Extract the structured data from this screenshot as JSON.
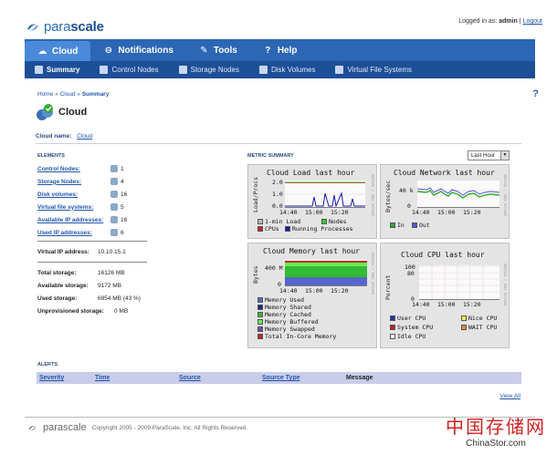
{
  "brand": {
    "logo_text_light": "para",
    "logo_text_bold": "scale"
  },
  "login": {
    "prefix": "Logged in as:",
    "user": "admin",
    "separator": "|",
    "logout": "Logout"
  },
  "topnav": [
    {
      "label": "Cloud",
      "icon": "cloud-icon"
    },
    {
      "label": "Notifications",
      "icon": "bell-icon"
    },
    {
      "label": "Tools",
      "icon": "wrench-icon"
    },
    {
      "label": "Help",
      "icon": "question-icon"
    }
  ],
  "subnav": [
    {
      "label": "Summary"
    },
    {
      "label": "Control Nodes"
    },
    {
      "label": "Storage Nodes"
    },
    {
      "label": "Disk Volumes"
    },
    {
      "label": "Virtual File Systems"
    }
  ],
  "breadcrumb": {
    "home": "Home",
    "cloud": "Cloud",
    "current": "Summary",
    "sep": "»"
  },
  "help_glyph": "?",
  "page": {
    "title": "Cloud",
    "cloud_name_label": "Cloud name:",
    "cloud_name_value": "Cloud"
  },
  "elements": {
    "heading": "ELEMENTS",
    "rows": [
      {
        "label": "Control Nodes:",
        "value": "1"
      },
      {
        "label": "Storage Nodes:",
        "value": "4"
      },
      {
        "label": "Disk volumes:",
        "value": "16"
      },
      {
        "label": "Virtual file systems:",
        "value": "5"
      },
      {
        "label": "Available IP addresses:",
        "value": "16"
      },
      {
        "label": "Used IP addresses:",
        "value": "6"
      }
    ],
    "virtual_ip_label": "Virtual IP address:",
    "virtual_ip_value": "10.10.15.1",
    "storage": [
      {
        "label": "Total storage:",
        "value": "16126 MB"
      },
      {
        "label": "Available storage:",
        "value": "9172 MB"
      },
      {
        "label": "Used storage:",
        "value": "6954 MB (43 %)"
      },
      {
        "label": "Unprovisioned storage:",
        "value": "0 MB"
      }
    ]
  },
  "metric": {
    "heading": "METRIC SUMMARY",
    "range_select": "Last Hour",
    "times": [
      "14:40",
      "15:00",
      "15:20"
    ],
    "load": {
      "title": "Cloud Load last hour",
      "ylabel": "Load/Procs",
      "yticks": [
        "2.0",
        "1.0",
        "0.0"
      ],
      "legend": [
        "1-min Load",
        "Nodes",
        "CPUs",
        "Running Processes"
      ],
      "side": "RRDTOOL / TOBI OETIKER"
    },
    "network": {
      "title": "Cloud Network last hour",
      "ylabel": "Bytes/sec",
      "yticks": [
        "40 k",
        "0"
      ],
      "legend": [
        "In",
        "Out"
      ],
      "side": "RRDTOOL / TOBI OETIKER"
    },
    "memory": {
      "title": "Cloud Memory last hour",
      "ylabel": "Bytes",
      "yticks": [
        "400 M",
        "0"
      ],
      "legend": [
        "Memory Used",
        "Memory Shared",
        "Memory Cached",
        "Memory Buffered",
        "Memory Swapped",
        "Total In-Core Memory"
      ],
      "side": "RRDTOOL / TOBI OETIKER"
    },
    "cpu": {
      "title": "Cloud CPU last hour",
      "ylabel": "Percent",
      "yticks": [
        "100",
        "80",
        "0"
      ],
      "legend": [
        "User CPU",
        "Nice CPU",
        "System CPU",
        "WAIT CPU",
        "Idle CPU"
      ],
      "side": "RRDTOOL / TOBI OETIKER"
    },
    "colors": {
      "load_1min": "#bbbbbb",
      "nodes": "#33cc33",
      "cpus": "#cc2222",
      "running": "#1a1aaa",
      "net_in": "#33aa33",
      "net_out": "#5555dd",
      "mem_used": "#5566cc",
      "mem_shared": "#1a2288",
      "mem_cached": "#33bb33",
      "mem_buffered": "#66ee55",
      "mem_swapped": "#7744aa",
      "mem_total": "#cc2222",
      "cpu_user": "#223399",
      "cpu_nice": "#eeee44",
      "cpu_system": "#bb2222",
      "cpu_wait": "#ee8833",
      "cpu_idle": "#ffffff"
    }
  },
  "alerts": {
    "heading": "ALERTS",
    "columns": [
      "Severity",
      "Time",
      "Source",
      "Source Type",
      "Message"
    ],
    "view_all": "View All"
  },
  "footer": {
    "logo": "parascale",
    "copyright": "Copyright 2005 - 2009 ParaScale, Inc. All Rights Reserved."
  },
  "watermark": {
    "cn": "中国存储网",
    "en": "ChinaStor.com"
  }
}
